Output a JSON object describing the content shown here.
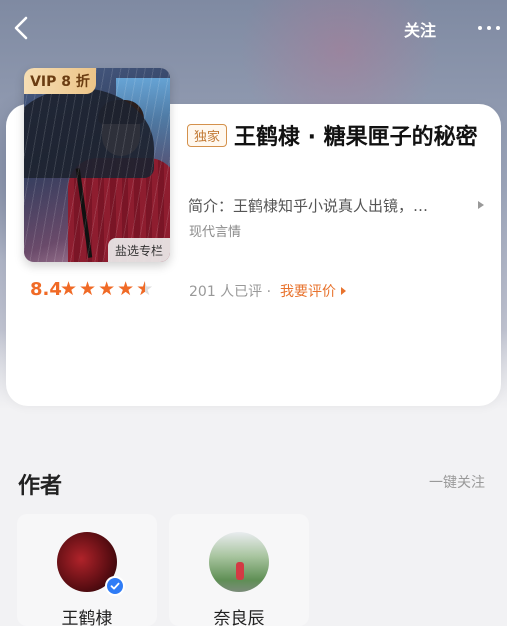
{
  "nav": {
    "follow_label": "关注"
  },
  "book": {
    "vip_badge": "VIP 8 折",
    "column_badge": "盐选专栏",
    "exclusive_tag": "独家",
    "title": "王鹤棣 · 糖果匣子的秘密",
    "intro": "简介：王鹤棣知乎小说真人出镜，…",
    "genre": "现代言情",
    "score": "8.4",
    "stars_value": 4.5,
    "stars_max": 5,
    "rating_count": "201 人已评 ·",
    "rate_label": "我要评价"
  },
  "authors": {
    "section_title": "作者",
    "follow_all_label": "一键关注",
    "items": [
      {
        "name": "王鹤棣",
        "verified": true
      },
      {
        "name": "奈良辰",
        "verified": false
      }
    ]
  },
  "colors": {
    "accent_orange": "#f06a26",
    "verify_blue": "#2f7cf6",
    "vip_gold": "#ecc488"
  }
}
